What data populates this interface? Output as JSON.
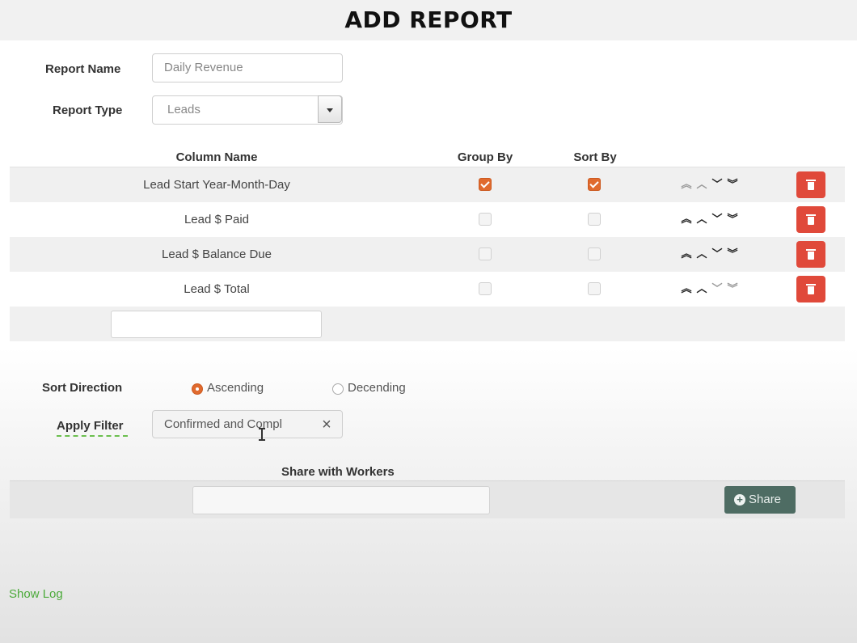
{
  "page": {
    "title": "ADD REPORT"
  },
  "form": {
    "report_name_label": "Report Name",
    "report_name_value": "Daily Revenue",
    "report_type_label": "Report Type",
    "report_type_value": "Leads"
  },
  "columns_table": {
    "headers": {
      "column_name": "Column Name",
      "group_by": "Group By",
      "sort_by": "Sort By"
    },
    "rows": [
      {
        "name": "Lead Start Year-Month-Day",
        "group_by": true,
        "sort_by": true
      },
      {
        "name": "Lead $ Paid",
        "group_by": false,
        "sort_by": false
      },
      {
        "name": "Lead $ Balance Due",
        "group_by": false,
        "sort_by": false
      },
      {
        "name": "Lead $ Total",
        "group_by": false,
        "sort_by": false
      }
    ],
    "new_column_value": ""
  },
  "sort_direction": {
    "label": "Sort Direction",
    "options": [
      "Ascending",
      "Decending"
    ],
    "selected": "Ascending"
  },
  "filter": {
    "label": "Apply Filter",
    "value": "Confirmed and Compl"
  },
  "share": {
    "label": "Share with Workers",
    "input_value": "",
    "button_label": "Share"
  },
  "footer": {
    "show_log_label": "Show Log"
  },
  "icons": {
    "move_top": "double-chevron-up-icon",
    "move_up": "chevron-up-icon",
    "move_down": "chevron-down-icon",
    "move_bottom": "double-chevron-down-icon",
    "delete": "trash-icon",
    "clear": "close-icon",
    "share": "plus-circle-icon"
  },
  "colors": {
    "accent": "#e06a2e",
    "delete_button": "#e0493a",
    "share_button": "#4e6c63",
    "link": "#4caa3a"
  }
}
